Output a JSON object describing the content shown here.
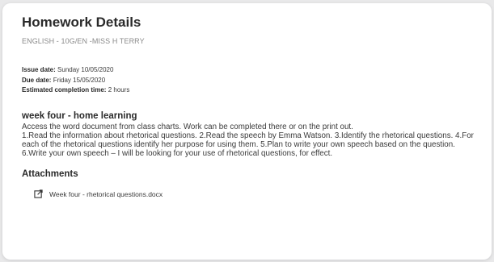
{
  "homework": {
    "title": "Homework Details",
    "subtitle": "ENGLISH - 10G/EN -MISS H TERRY",
    "issue_label": "Issue date:",
    "issue_value": "Sunday 10/05/2020",
    "due_label": "Due date:",
    "due_value": "Friday 15/05/2020",
    "completion_label": "Estimated completion time:",
    "completion_value": "2 hours"
  },
  "task": {
    "title": "week four - home learning",
    "paragraph1": "Access the word document from class charts. Work can be completed there or on the print out.",
    "paragraph2": "1.Read the information about rhetorical questions. 2.Read the speech by Emma Watson. 3.Identify the rhetorical questions. 4.For each of the rhetorical questions identify her purpose for using them. 5.Plan to write your own speech based on the question. 6.Write your own speech – I will be looking for your use of rhetorical questions, for effect."
  },
  "attachments": {
    "title": "Attachments",
    "items": [
      {
        "label": "Week four - rhetorical questions.docx",
        "icon": "external-link-icon"
      }
    ]
  }
}
